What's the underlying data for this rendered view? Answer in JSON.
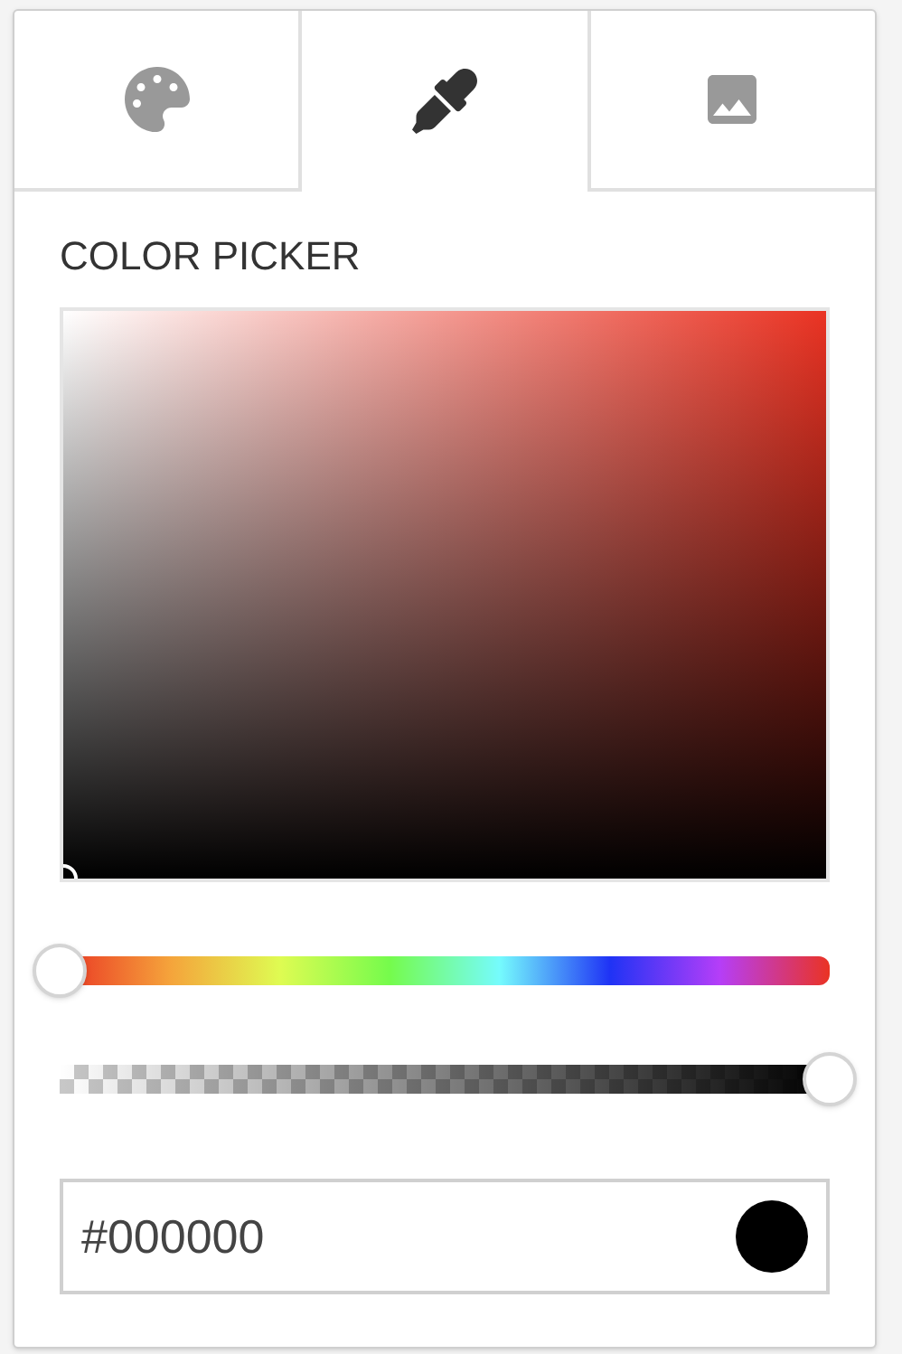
{
  "tabs": [
    {
      "kind": "palette",
      "selected": false
    },
    {
      "kind": "eyedropper",
      "selected": true
    },
    {
      "kind": "image",
      "selected": false
    }
  ],
  "title": "COLOR PICKER",
  "hue_slider": {
    "level": 0
  },
  "alpha_slider": {
    "level": 1
  },
  "hex_field": {
    "value": "#000000",
    "color": "#000000"
  }
}
